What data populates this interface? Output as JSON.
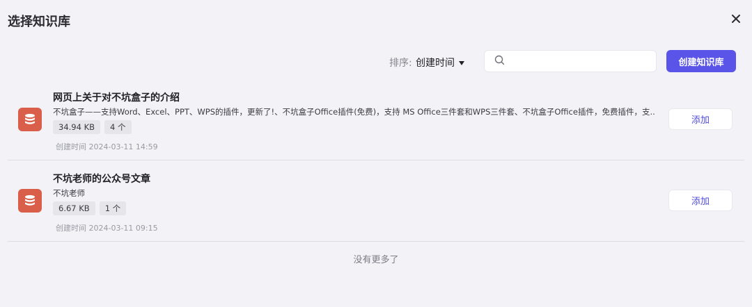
{
  "dialog": {
    "title": "选择知识库"
  },
  "toolbar": {
    "sort_label": "排序:",
    "sort_value": "创建时间",
    "search_value": "",
    "create_label": "创建知识库"
  },
  "items": [
    {
      "name": "网页上关于对不坑盒子的介绍",
      "description": "不坑盒子——支持Word、Excel、PPT、WPS的插件，更新了!、不坑盒子Office插件(免费)，支持 MS Office三件套和WPS三件套、不坑盒子Office插件，免费插件，支...",
      "size": "34.94 KB",
      "count": "4 个",
      "created": "创建时间 2024-03-11 14:59",
      "add_label": "添加"
    },
    {
      "name": "不坑老师的公众号文章",
      "description": "不坑老师",
      "size": "6.67 KB",
      "count": "1 个",
      "created": "创建时间 2024-03-11 09:15",
      "add_label": "添加"
    }
  ],
  "footer": {
    "no_more": "没有更多了"
  },
  "colors": {
    "accent": "#5a55e8",
    "icon_bg": "#d95f4b",
    "background": "#f3f2f7"
  }
}
